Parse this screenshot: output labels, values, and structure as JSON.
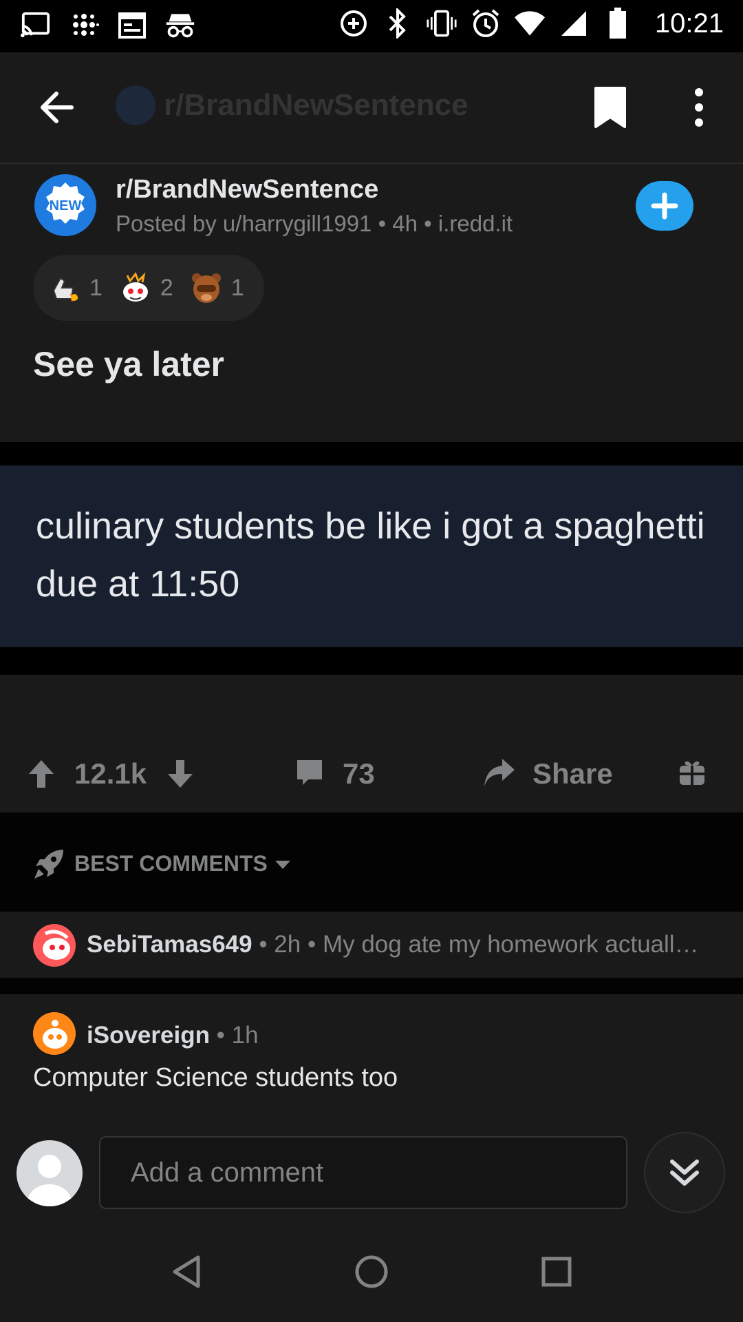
{
  "status_bar": {
    "time": "10:21",
    "icons_left": [
      "cast-icon",
      "fitbit-icon",
      "calendar-icon",
      "incognito-icon"
    ],
    "icons_right": [
      "data-saver-icon",
      "bluetooth-icon",
      "vibrate-icon",
      "alarm-icon",
      "wifi-icon",
      "signal-icon",
      "battery-icon"
    ]
  },
  "app_bar": {
    "subreddit": "r/BrandNewSentence"
  },
  "post": {
    "subreddit": "r/BrandNewSentence",
    "subreddit_badge": "NEW",
    "meta": "Posted by u/harrygill1991 • 4h • i.redd.it",
    "awards": [
      {
        "icon": "thumbs-up-rocket-award-icon",
        "count": "1"
      },
      {
        "icon": "snoo-burst-award-icon",
        "count": "2"
      },
      {
        "icon": "facepalm-bear-award-icon",
        "count": "1"
      }
    ],
    "title": "See ya later",
    "image_text": "culinary students be like i got a spaghetti due at 11:50",
    "score": "12.1k",
    "comments": "73",
    "share_label": "Share"
  },
  "sort": {
    "label": "BEST COMMENTS"
  },
  "comments": [
    {
      "user": "SebiTamas649",
      "meta": " • 2h • ",
      "preview": "My dog ate my homework actuall…"
    },
    {
      "user": "iSovereign",
      "meta": " • 1h",
      "body": "Computer Science students too"
    }
  ],
  "compose": {
    "placeholder": "Add a comment"
  },
  "colors": {
    "background": "#1a1a1b",
    "accent_blue": "#24a0ed",
    "muted_text": "#818384"
  }
}
